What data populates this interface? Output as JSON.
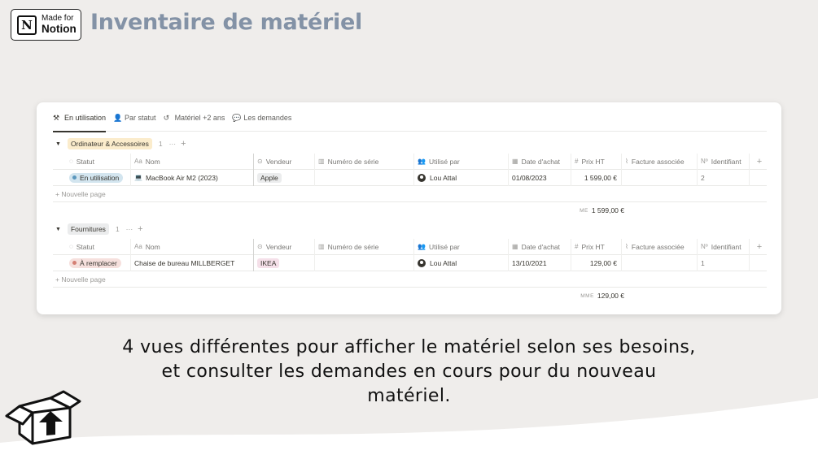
{
  "badge": {
    "line1": "Made for",
    "line2": "Notion",
    "logo_letter": "N"
  },
  "title": "Inventaire de matériel",
  "tabs": [
    {
      "label": "En utilisation",
      "icon": "⚒",
      "active": true
    },
    {
      "label": "Par statut",
      "icon": "👤",
      "active": false
    },
    {
      "label": "Matériel +2 ans",
      "icon": "↺",
      "active": false
    },
    {
      "label": "Les demandes",
      "icon": "💬",
      "active": false
    }
  ],
  "columns": [
    {
      "label": "Statut",
      "icon": "◌"
    },
    {
      "label": "Nom",
      "icon": "Aa"
    },
    {
      "label": "Vendeur",
      "icon": "⊙"
    },
    {
      "label": "Numéro de série",
      "icon": "▥"
    },
    {
      "label": "Utilisé par",
      "icon": "👥"
    },
    {
      "label": "Date d'achat",
      "icon": "▦"
    },
    {
      "label": "Prix HT",
      "icon": "#"
    },
    {
      "label": "Facture associée",
      "icon": "⌇"
    },
    {
      "label": "Identifiant",
      "icon": "Nº"
    }
  ],
  "groups": [
    {
      "name": "Ordinateur & Accessoires",
      "count": "1",
      "row": {
        "statut": "En utilisation",
        "nom": "MacBook Air M2 (2023)",
        "vendeur": "Apple",
        "numero": "",
        "utilise_par": "Lou Attal",
        "date": "01/08/2023",
        "prix": "1 599,00 €",
        "facture": "",
        "identifiant": "2"
      },
      "summary_label": "ME",
      "summary_value": "1 599,00 €"
    },
    {
      "name": "Fournitures",
      "count": "1",
      "row": {
        "statut": "À remplacer",
        "nom": "Chaise de bureau MILLBERGET",
        "vendeur": "IKEA",
        "numero": "",
        "utilise_par": "Lou Attal",
        "date": "13/10/2021",
        "prix": "129,00 €",
        "facture": "",
        "identifiant": "1"
      },
      "summary_label": "MME",
      "summary_value": "129,00 €"
    }
  ],
  "new_page_label": "+ Nouvelle page",
  "caption": "4 vues différentes pour afficher le matériel selon ses besoins, et consulter les demandes en cours pour du nouveau matériel.",
  "colors": {
    "title": "#8392a6",
    "background": "#efedeb",
    "status_blue": "#d3e5ef",
    "status_red": "#f6e0dd"
  }
}
